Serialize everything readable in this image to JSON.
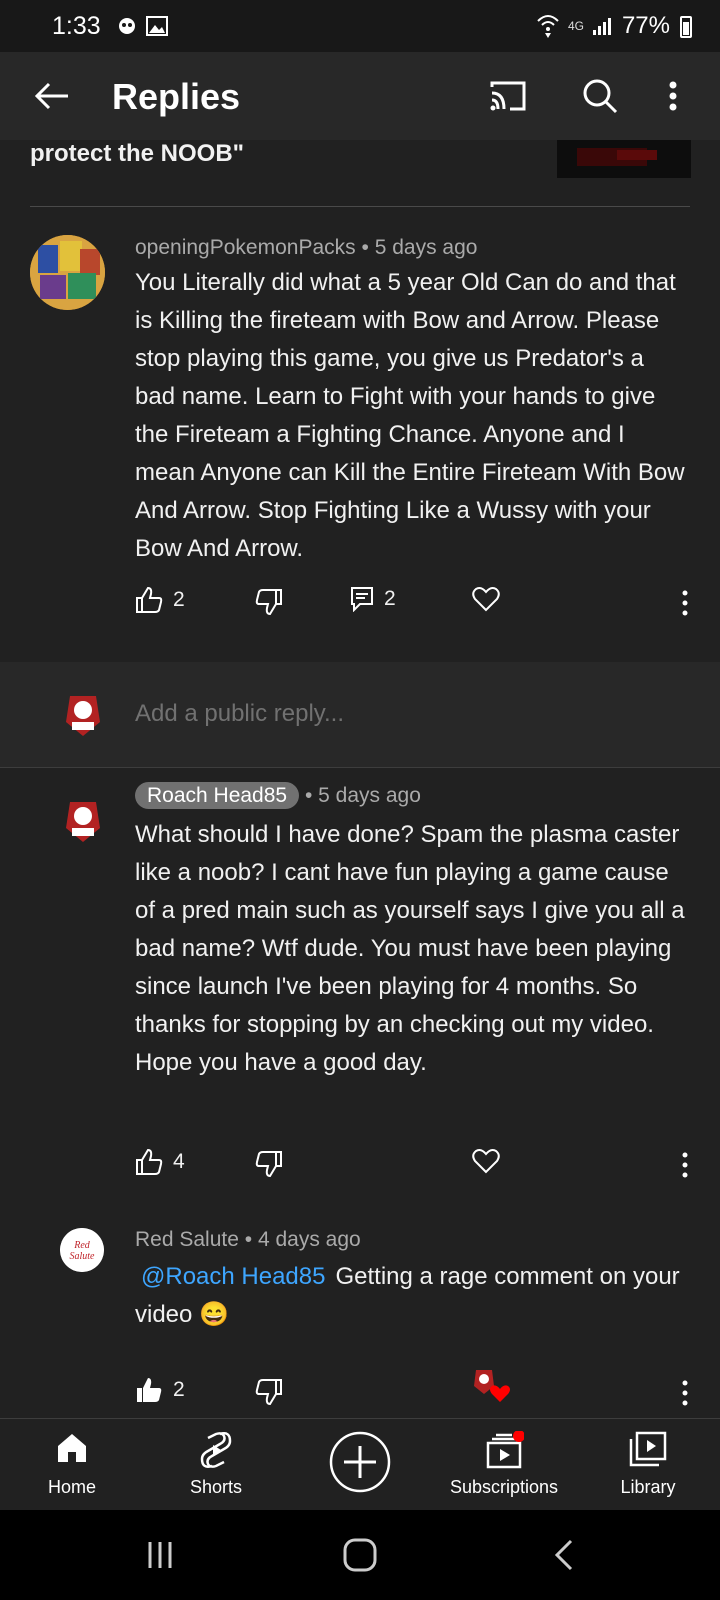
{
  "status": {
    "time": "1:33",
    "network": "4G",
    "battery": "77%"
  },
  "appbar": {
    "title": "Replies"
  },
  "previous": {
    "text_tail": "protect the NOOB\""
  },
  "comments": [
    {
      "author": "openingPokemonPacks",
      "age": "5 days ago",
      "separator": "•",
      "text": "You Literally did what a 5 year Old Can do and that is Killing the fireteam with Bow and Arrow. Please stop playing this game, you give us Predator's a bad name. Learn to Fight with your hands to give the Fireteam a Fighting Chance. Anyone and I mean Anyone can Kill the Entire Fireteam With Bow And Arrow. Stop Fighting Like a Wussy with your Bow And Arrow.",
      "likes": "2",
      "replies": "2"
    },
    {
      "author": "Roach Head85",
      "age": "5 days ago",
      "separator": "•",
      "text": "What should I have done? Spam the plasma caster like a noob? I cant have fun playing a game cause of a pred main such as yourself says I give you all a bad name? Wtf dude. You must have been playing since launch I've been playing for 4 months. So thanks for stopping by an checking out my video. Hope you have a good day.",
      "likes": "4"
    },
    {
      "author": "Red Salute",
      "age": "4 days ago",
      "separator": "•",
      "mention": "@Roach Head85",
      "text": "Getting a rage comment on your video 😄",
      "likes": "2",
      "avatar_text": "Red Salute"
    }
  ],
  "reply_box": {
    "placeholder": "Add a public reply..."
  },
  "nav": {
    "home": "Home",
    "shorts": "Shorts",
    "subscriptions": "Subscriptions",
    "library": "Library"
  },
  "colors": {
    "accent_link": "#3ea6ff",
    "notification_dot": "#ff0000"
  }
}
